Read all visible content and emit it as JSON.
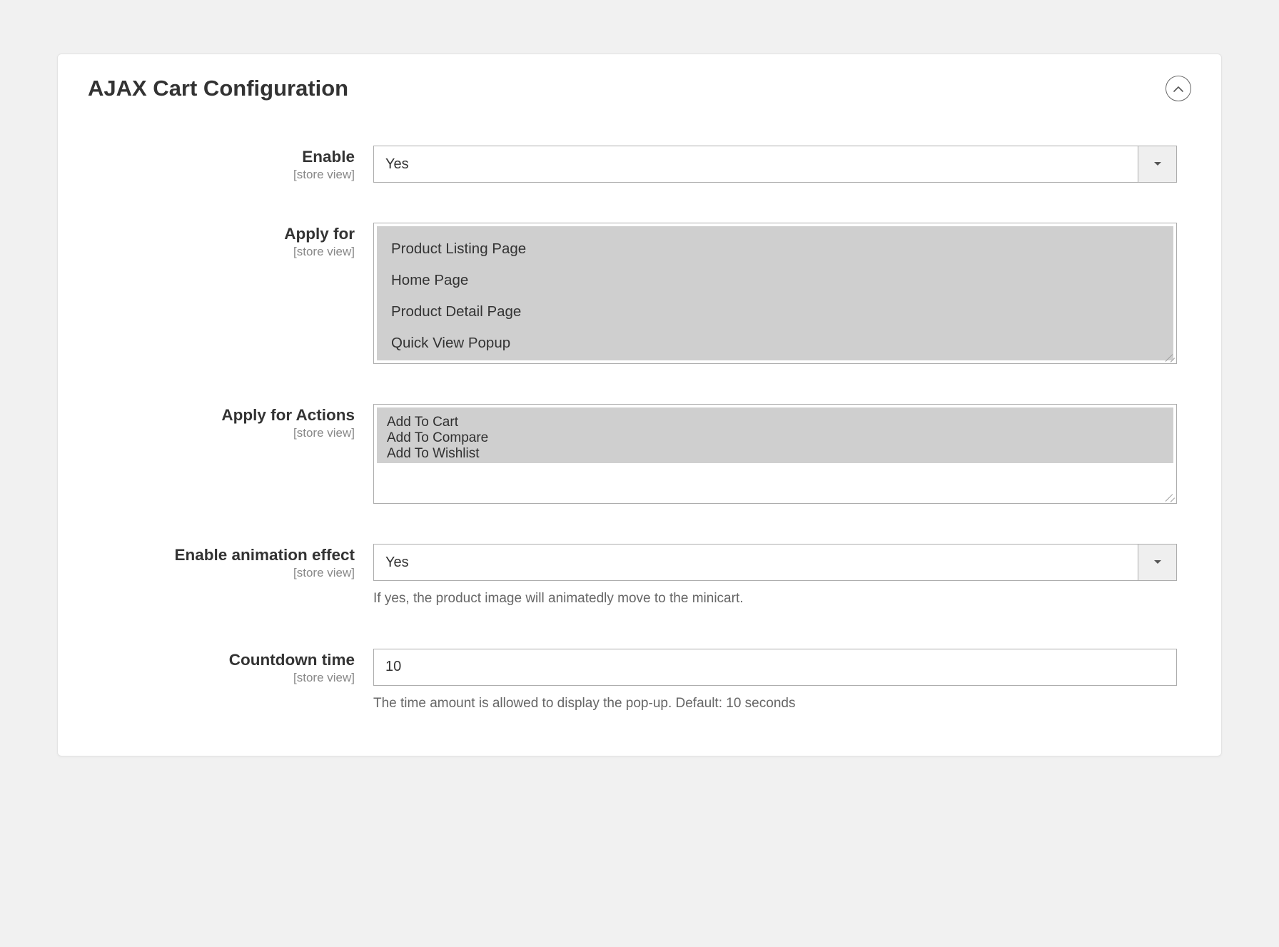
{
  "panel": {
    "title": "AJAX Cart Configuration"
  },
  "scope_label": "[store view]",
  "fields": {
    "enable": {
      "label": "Enable",
      "value": "Yes"
    },
    "apply_for": {
      "label": "Apply for",
      "options": [
        "Product Listing Page",
        "Home Page",
        "Product Detail Page",
        "Quick View Popup"
      ]
    },
    "apply_for_actions": {
      "label": "Apply for Actions",
      "options": [
        "Add To Cart",
        "Add To Compare",
        "Add To Wishlist"
      ]
    },
    "enable_animation": {
      "label": "Enable animation effect",
      "value": "Yes",
      "note": "If yes, the product image will animatedly move to the minicart."
    },
    "countdown_time": {
      "label": "Countdown time",
      "value": "10",
      "note": "The time amount is allowed to display the pop-up. Default: 10 seconds"
    }
  }
}
